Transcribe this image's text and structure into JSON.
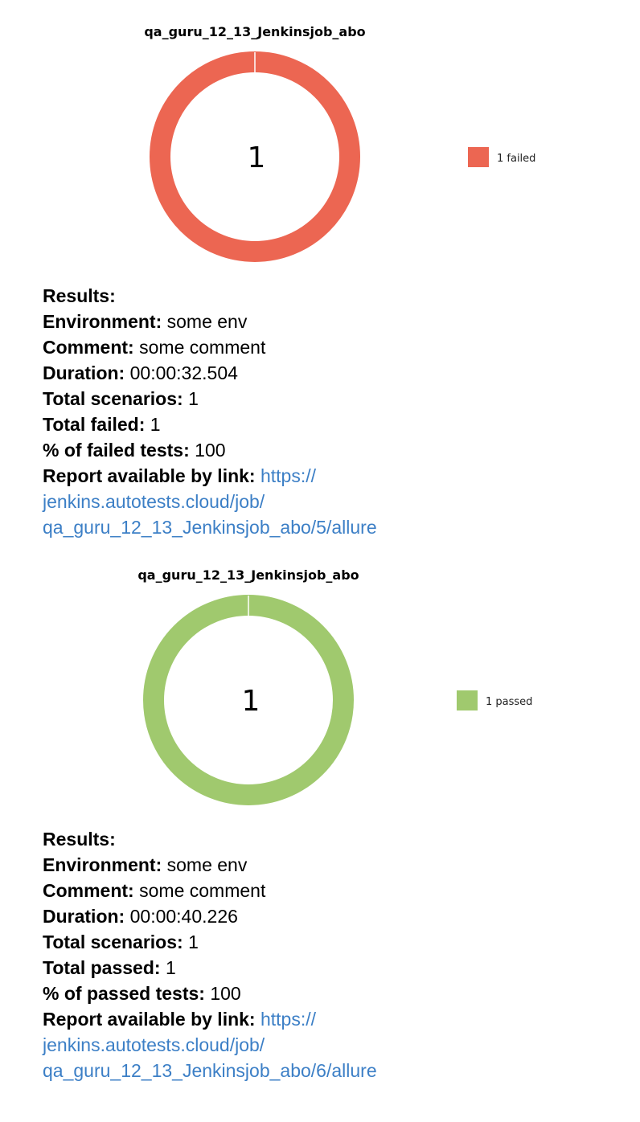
{
  "reports": [
    {
      "title": "qa_guru_12_13_Jenkinsjob_abo",
      "ring_color": "#ec6652",
      "center_value": "1",
      "legend_label": "1 failed",
      "results_heading": "Results:",
      "environment_label": "Environment:",
      "environment_value": "some env",
      "comment_label": "Comment:",
      "comment_value": "some comment",
      "duration_label": "Duration:",
      "duration_value": "00:00:32.504",
      "total_scenarios_label": "Total scenarios:",
      "total_scenarios_value": "1",
      "total_status_label": "Total failed:",
      "total_status_value": "1",
      "percent_label": "% of failed tests:",
      "percent_value": "100",
      "report_label": "Report available by link:",
      "report_link_1": "https://",
      "report_link_2": "jenkins.autotests.cloud/job/",
      "report_link_3": "qa_guru_12_13_Jenkinsjob_abo/5/allure"
    },
    {
      "title": "qa_guru_12_13_Jenkinsjob_abo",
      "ring_color": "#a0c96e",
      "center_value": "1",
      "legend_label": "1 passed",
      "results_heading": "Results:",
      "environment_label": "Environment:",
      "environment_value": "some env",
      "comment_label": "Comment:",
      "comment_value": "some comment",
      "duration_label": "Duration:",
      "duration_value": "00:00:40.226",
      "total_scenarios_label": "Total scenarios:",
      "total_scenarios_value": "1",
      "total_status_label": "Total passed:",
      "total_status_value": "1",
      "percent_label": "% of passed tests:",
      "percent_value": "100",
      "report_label": "Report available by link:",
      "report_link_1": "https://",
      "report_link_2": "jenkins.autotests.cloud/job/",
      "report_link_3": "qa_guru_12_13_Jenkinsjob_abo/6/allure"
    }
  ],
  "link_color": "#3c7fc6"
}
